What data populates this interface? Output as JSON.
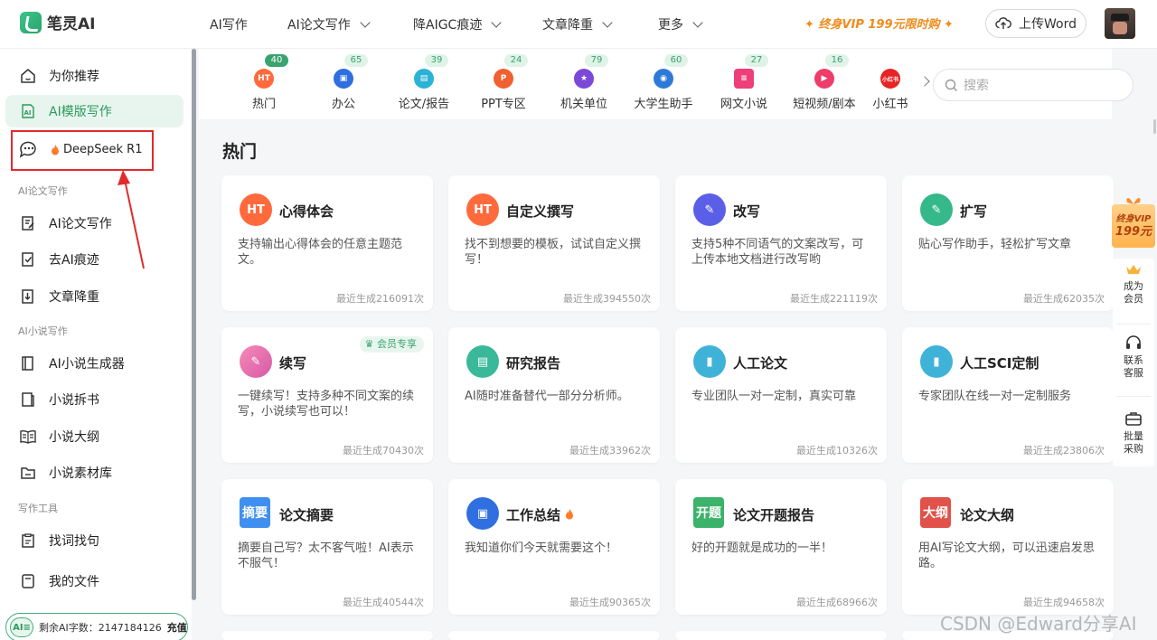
{
  "brand": {
    "name": "笔灵AI"
  },
  "topnav": {
    "items": [
      {
        "label": "AI写作",
        "has_dropdown": false
      },
      {
        "label": "AI论文写作",
        "has_dropdown": true
      },
      {
        "label": "降AIGC痕迹",
        "has_dropdown": true
      },
      {
        "label": "文章降重",
        "has_dropdown": true
      },
      {
        "label": "更多",
        "has_dropdown": true
      }
    ],
    "vip_promo": "终身VIP 199元限时购",
    "upload_label": "上传Word"
  },
  "sidebar": {
    "items": [
      {
        "label": "为你推荐",
        "icon": "home-icon"
      },
      {
        "label": "AI模版写作",
        "icon": "ai-template-icon",
        "active": true
      },
      {
        "label": "DeepSeek R1",
        "icon": "chat-bubble-icon"
      }
    ],
    "sections": [
      {
        "title": "AI论文写作",
        "items": [
          "AI论文写作",
          "去AI痕迹",
          "文章降重"
        ]
      },
      {
        "title": "AI小说写作",
        "items": [
          "AI小说生成器",
          "小说拆书",
          "小说大纲",
          "小说素材库"
        ]
      },
      {
        "title": "写作工具",
        "items": [
          "找词找句"
        ]
      }
    ],
    "my_files": "我的文件",
    "credits": {
      "badge": "AI≡",
      "label": "剩余AI字数：",
      "value": "2147184126",
      "recharge": "充值"
    }
  },
  "categories": [
    {
      "label": "热门",
      "count": "40",
      "color": "#ff6a3d",
      "icon_text": "HT",
      "active": true
    },
    {
      "label": "办公",
      "count": "65",
      "color": "#2f6fe0",
      "icon_text": "▣"
    },
    {
      "label": "论文/报告",
      "count": "39",
      "color": "#2bb3d6",
      "icon_text": "▤"
    },
    {
      "label": "PPT专区",
      "count": "24",
      "color": "#f06030",
      "icon_text": "P"
    },
    {
      "label": "机关单位",
      "count": "79",
      "color": "#7b48d8",
      "icon_text": "★"
    },
    {
      "label": "大学生助手",
      "count": "60",
      "color": "#2f7ad8",
      "icon_text": "◉"
    },
    {
      "label": "网文小说",
      "count": "27",
      "color": "#ef3f7a",
      "icon_text": "≡"
    },
    {
      "label": "短视频/剧本",
      "count": "16",
      "color": "#ee3d6a",
      "icon_text": "▶"
    },
    {
      "label": "小红书",
      "count": "",
      "color": "#e82323",
      "icon_text": "小红书"
    }
  ],
  "search": {
    "placeholder": "搜索"
  },
  "main": {
    "section_title": "热门",
    "cards": [
      {
        "title": "心得体会",
        "desc": "支持输出心得体会的任意主题范文。",
        "meta": "最近生成216091次",
        "icon_text": "HT",
        "color": "#ff6a3d",
        "shape": "round"
      },
      {
        "title": "自定义撰写",
        "desc": "找不到想要的模板，试试自定义撰写！",
        "meta": "最近生成394550次",
        "icon_text": "HT",
        "color": "#ff6a3d",
        "shape": "round"
      },
      {
        "title": "改写",
        "desc": "支持5种不同语气的文案改写，可上传本地文档进行改写哟",
        "meta": "最近生成221119次",
        "icon_text": "✎",
        "color": "#5b5fe8",
        "shape": "round"
      },
      {
        "title": "扩写",
        "desc": "贴心写作助手，轻松扩写文章",
        "meta": "最近生成62035次",
        "icon_text": "✎",
        "color": "#35b88a",
        "shape": "round"
      },
      {
        "title": "续写",
        "desc": "一键续写！支持多种不同文案的续写，小说续写也可以！",
        "meta": "最近生成70430次",
        "icon_text": "✎",
        "color": "#f06aa0",
        "shape": "round",
        "badge": "会员专享"
      },
      {
        "title": "研究报告",
        "desc": "AI随时准备替代一部分分析师。",
        "meta": "最近生成33962次",
        "icon_text": "▤",
        "color": "#3ab89a",
        "shape": "round"
      },
      {
        "title": "人工论文",
        "desc": "专业团队一对一定制，真实可靠",
        "meta": "最近生成10326次",
        "icon_text": "▮",
        "color": "#3fb2d8",
        "shape": "round"
      },
      {
        "title": "人工SCI定制",
        "desc": "专家团队在线一对一定制服务",
        "meta": "最近生成23806次",
        "icon_text": "▮",
        "color": "#3fb2d8",
        "shape": "round"
      },
      {
        "title": "论文摘要",
        "desc": "摘要自己写？太不客气啦！AI表示不服气！",
        "meta": "最近生成40544次",
        "icon_text": "摘要",
        "color": "#3f8ff0",
        "shape": "square"
      },
      {
        "title": "工作总结",
        "desc": "我知道你们今天就需要这个！",
        "meta": "最近生成90365次",
        "icon_text": "▣",
        "color": "#2f6fe0",
        "shape": "round",
        "hot": true
      },
      {
        "title": "论文开题报告",
        "desc": "好的开题就是成功的一半！",
        "meta": "最近生成68966次",
        "icon_text": "开题",
        "color": "#3bb36a",
        "shape": "square"
      },
      {
        "title": "论文大纲",
        "desc": "用AI写论文大纲，可以迅速启发思路。",
        "meta": "最近生成94658次",
        "icon_text": "大纲",
        "color": "#e0524a",
        "shape": "square"
      }
    ]
  },
  "float_panel": {
    "vip": {
      "line1": "终身VIP",
      "line2": "199元"
    },
    "items": [
      "成为会员",
      "联系客服",
      "批量采购"
    ]
  },
  "watermark": "CSDN @Edward分享AI"
}
